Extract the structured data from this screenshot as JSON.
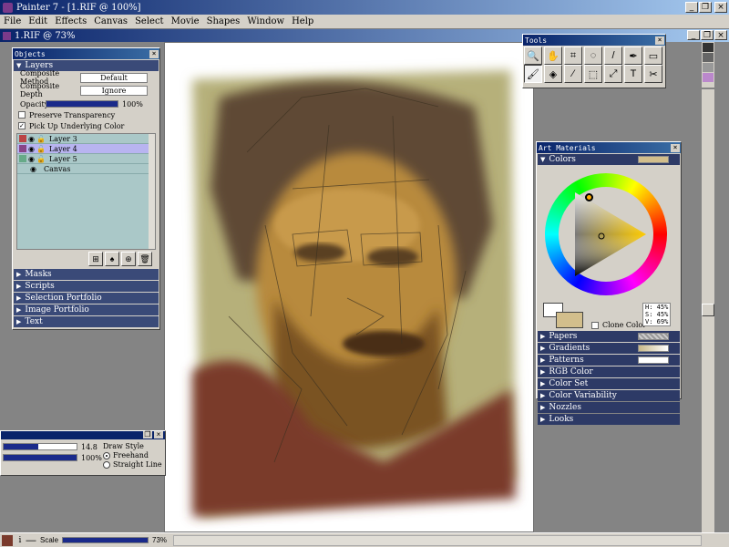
{
  "app": {
    "title": "Painter 7 - [1.RIF @ 100%]"
  },
  "menu": [
    "File",
    "Edit",
    "Effects",
    "Canvas",
    "Select",
    "Movie",
    "Shapes",
    "Window",
    "Help"
  ],
  "document": {
    "title": "1.RIF @ 73%"
  },
  "objects": {
    "title": "Objects",
    "layers_label": "Layers",
    "composite_method_label": "Composite Method",
    "composite_method_value": "Default",
    "composite_depth_label": "Composite Depth",
    "composite_depth_value": "Ignore",
    "opacity_label": "Opacity",
    "opacity_value": "100%",
    "preserve_label": "Preserve Transparency",
    "pickup_label": "Pick Up Underlying Color",
    "layers": [
      "Layer 3",
      "Layer 4",
      "Layer 5",
      "Canvas"
    ],
    "sections": [
      "Masks",
      "Scripts",
      "Selection Portfolio",
      "Image Portfolio",
      "Text"
    ]
  },
  "tools": {
    "title": "Tools"
  },
  "art": {
    "title": "Art Materials",
    "colors_label": "Colors",
    "hsv": {
      "h": "H: 45%",
      "s": "S: 45%",
      "v": "V: 69%"
    },
    "clone_color": "Clone Color",
    "rows": [
      "Papers",
      "Gradients",
      "Patterns",
      "RGB Color",
      "Color Set",
      "Color Variability",
      "Nozzles",
      "Looks"
    ]
  },
  "brush": {
    "size_value": "14.8",
    "opacity_value": "100%",
    "draw_style_label": "Draw Style",
    "freehand": "Freehand",
    "straight": "Straight Line"
  },
  "status": {
    "scale_label": "Scale",
    "scale_value": "73%"
  },
  "colors": {
    "title_blue": "#0a246a",
    "section": "#3a4a78",
    "primary": "#d2be8c"
  }
}
